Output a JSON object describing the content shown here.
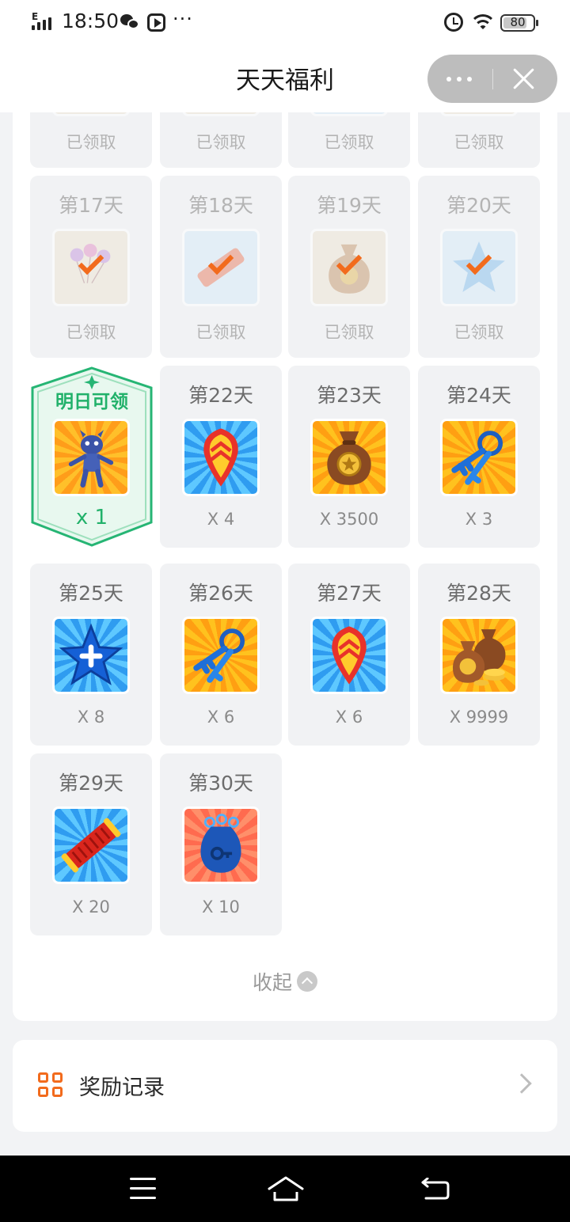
{
  "status_bar": {
    "network": "E",
    "time": "18:50",
    "more": "···",
    "battery": "80",
    "battery_level": 0.8
  },
  "header": {
    "title": "天天福利"
  },
  "capsule": {
    "menu_icon": "more-dots-icon",
    "close_icon": "close-icon"
  },
  "top_row": [
    {
      "status": "已领取"
    },
    {
      "status": "已领取"
    },
    {
      "status": "已领取"
    },
    {
      "status": "已领取"
    }
  ],
  "claimed_row": [
    {
      "day": "第17天",
      "status": "已领取",
      "item_icon": "balloons-icon"
    },
    {
      "day": "第18天",
      "status": "已领取",
      "item_icon": "firecracker-icon"
    },
    {
      "day": "第19天",
      "status": "已领取",
      "item_icon": "coin-bag-icon"
    },
    {
      "day": "第20天",
      "status": "已领取",
      "item_icon": "star-icon"
    }
  ],
  "tomorrow": {
    "label": "明日可领",
    "quantity": "x 1",
    "item_icon": "mascot-character-icon"
  },
  "days": [
    {
      "day": "第22天",
      "quantity": "X 4",
      "item_icon": "rocket-boost-icon",
      "tile": "blue"
    },
    {
      "day": "第23天",
      "quantity": "X 3500",
      "item_icon": "coin-bag-icon",
      "tile": "orange"
    },
    {
      "day": "第24天",
      "quantity": "X 3",
      "item_icon": "keys-icon",
      "tile": "orange"
    },
    {
      "day": "第25天",
      "quantity": "X 8",
      "item_icon": "star-plus-icon",
      "tile": "blue"
    },
    {
      "day": "第26天",
      "quantity": "X 6",
      "item_icon": "keys-icon",
      "tile": "orange"
    },
    {
      "day": "第27天",
      "quantity": "X 6",
      "item_icon": "rocket-boost-icon",
      "tile": "blue"
    },
    {
      "day": "第28天",
      "quantity": "X 9999",
      "item_icon": "coin-bags-icon",
      "tile": "orange"
    },
    {
      "day": "第29天",
      "quantity": "X 20",
      "item_icon": "firecracker-icon",
      "tile": "blue"
    },
    {
      "day": "第30天",
      "quantity": "X 10",
      "item_icon": "key-bag-icon",
      "tile": "red"
    }
  ],
  "collapse": {
    "label": "收起"
  },
  "reward_record": {
    "label": "奖励记录"
  },
  "colors": {
    "accent_orange": "#f26b1d",
    "accent_green": "#21b16a",
    "cell_bg": "#f1f2f4",
    "page_bg": "#f2f3f5"
  }
}
